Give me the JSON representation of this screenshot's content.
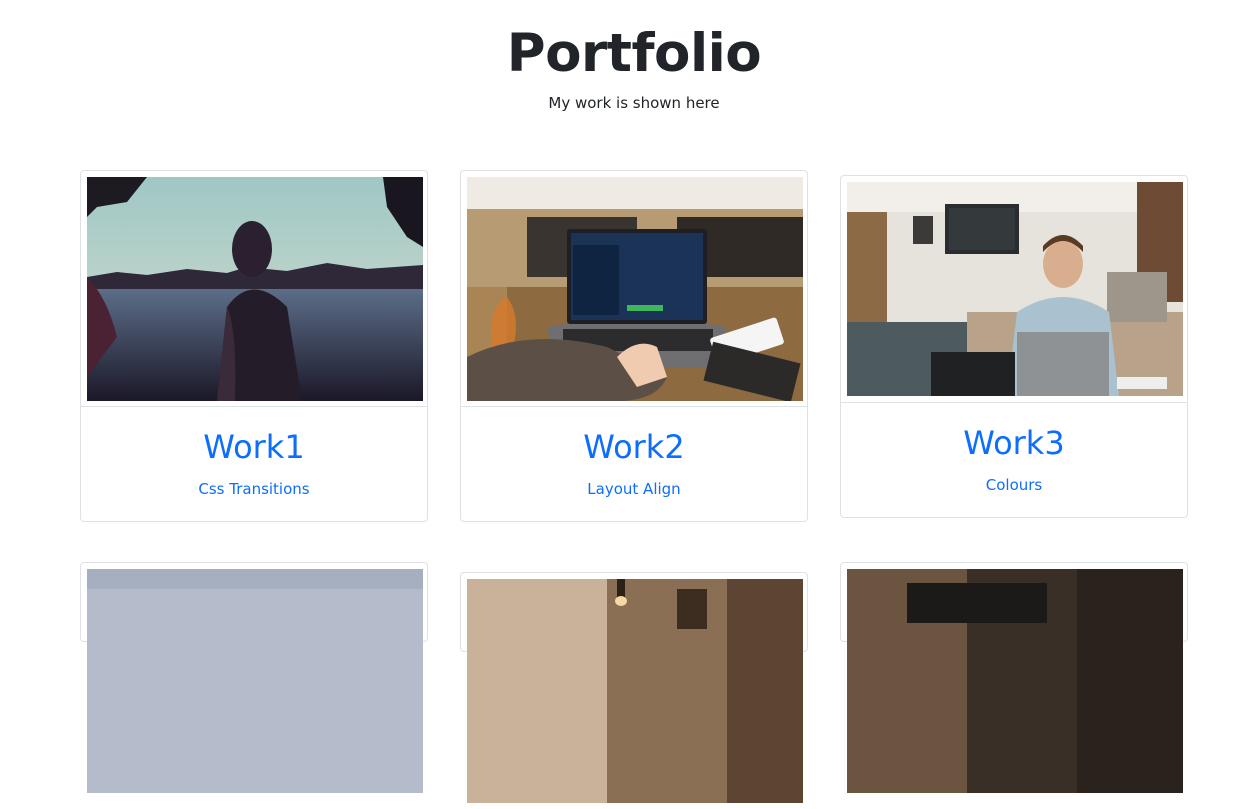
{
  "header": {
    "title": "Portfolio",
    "subtitle": "My work is shown here"
  },
  "colors": {
    "link": "#0d6efd",
    "text": "#212529",
    "border": "#dee2e6"
  },
  "cards": [
    {
      "title": "Work1",
      "subtitle": "Css Transitions",
      "image": "woman-silhouette-at-lake-sunset-photo"
    },
    {
      "title": "Work2",
      "subtitle": "Layout Align",
      "image": "laptop-on-cafe-table-photo"
    },
    {
      "title": "Work3",
      "subtitle": "Colours",
      "image": "man-with-laptop-in-cafe-photo"
    },
    {
      "title": "",
      "subtitle": "",
      "image": "sky-landscape-photo"
    },
    {
      "title": "",
      "subtitle": "",
      "image": "interior-lamp-photo"
    },
    {
      "title": "",
      "subtitle": "",
      "image": "dark-desk-laptop-photo"
    }
  ]
}
